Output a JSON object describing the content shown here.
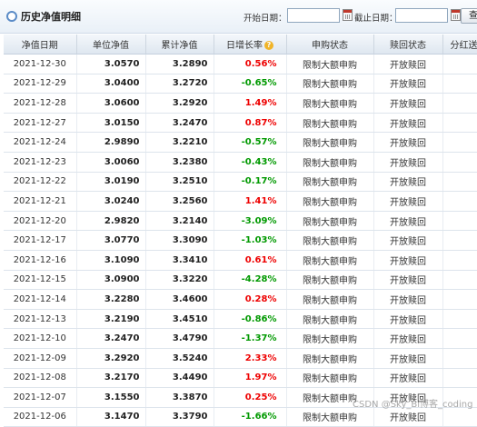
{
  "header": {
    "title": "历史净值明细",
    "start_label": "开始日期：",
    "end_label": "截止日期：",
    "start_value": "",
    "end_value": "",
    "query_label": "查"
  },
  "columns": [
    "净值日期",
    "单位净值",
    "累计净值",
    "日增长率",
    "申购状态",
    "赎回状态",
    "分红送配"
  ],
  "rows": [
    {
      "date": "2021-12-30",
      "nav": "3.0570",
      "acc": "3.2890",
      "chg": "0.56%",
      "dir": "up",
      "buy": "限制大额申购",
      "redeem": "开放赎回"
    },
    {
      "date": "2021-12-29",
      "nav": "3.0400",
      "acc": "3.2720",
      "chg": "-0.65%",
      "dir": "down",
      "buy": "限制大额申购",
      "redeem": "开放赎回"
    },
    {
      "date": "2021-12-28",
      "nav": "3.0600",
      "acc": "3.2920",
      "chg": "1.49%",
      "dir": "up",
      "buy": "限制大额申购",
      "redeem": "开放赎回"
    },
    {
      "date": "2021-12-27",
      "nav": "3.0150",
      "acc": "3.2470",
      "chg": "0.87%",
      "dir": "up",
      "buy": "限制大额申购",
      "redeem": "开放赎回"
    },
    {
      "date": "2021-12-24",
      "nav": "2.9890",
      "acc": "3.2210",
      "chg": "-0.57%",
      "dir": "down",
      "buy": "限制大额申购",
      "redeem": "开放赎回"
    },
    {
      "date": "2021-12-23",
      "nav": "3.0060",
      "acc": "3.2380",
      "chg": "-0.43%",
      "dir": "down",
      "buy": "限制大额申购",
      "redeem": "开放赎回"
    },
    {
      "date": "2021-12-22",
      "nav": "3.0190",
      "acc": "3.2510",
      "chg": "-0.17%",
      "dir": "down",
      "buy": "限制大额申购",
      "redeem": "开放赎回"
    },
    {
      "date": "2021-12-21",
      "nav": "3.0240",
      "acc": "3.2560",
      "chg": "1.41%",
      "dir": "up",
      "buy": "限制大额申购",
      "redeem": "开放赎回"
    },
    {
      "date": "2021-12-20",
      "nav": "2.9820",
      "acc": "3.2140",
      "chg": "-3.09%",
      "dir": "down",
      "buy": "限制大额申购",
      "redeem": "开放赎回"
    },
    {
      "date": "2021-12-17",
      "nav": "3.0770",
      "acc": "3.3090",
      "chg": "-1.03%",
      "dir": "down",
      "buy": "限制大额申购",
      "redeem": "开放赎回"
    },
    {
      "date": "2021-12-16",
      "nav": "3.1090",
      "acc": "3.3410",
      "chg": "0.61%",
      "dir": "up",
      "buy": "限制大额申购",
      "redeem": "开放赎回"
    },
    {
      "date": "2021-12-15",
      "nav": "3.0900",
      "acc": "3.3220",
      "chg": "-4.28%",
      "dir": "down",
      "buy": "限制大额申购",
      "redeem": "开放赎回"
    },
    {
      "date": "2021-12-14",
      "nav": "3.2280",
      "acc": "3.4600",
      "chg": "0.28%",
      "dir": "up",
      "buy": "限制大额申购",
      "redeem": "开放赎回"
    },
    {
      "date": "2021-12-13",
      "nav": "3.2190",
      "acc": "3.4510",
      "chg": "-0.86%",
      "dir": "down",
      "buy": "限制大额申购",
      "redeem": "开放赎回"
    },
    {
      "date": "2021-12-10",
      "nav": "3.2470",
      "acc": "3.4790",
      "chg": "-1.37%",
      "dir": "down",
      "buy": "限制大额申购",
      "redeem": "开放赎回"
    },
    {
      "date": "2021-12-09",
      "nav": "3.2920",
      "acc": "3.5240",
      "chg": "2.33%",
      "dir": "up",
      "buy": "限制大额申购",
      "redeem": "开放赎回"
    },
    {
      "date": "2021-12-08",
      "nav": "3.2170",
      "acc": "3.4490",
      "chg": "1.97%",
      "dir": "up",
      "buy": "限制大额申购",
      "redeem": "开放赎回"
    },
    {
      "date": "2021-12-07",
      "nav": "3.1550",
      "acc": "3.3870",
      "chg": "0.25%",
      "dir": "up",
      "buy": "限制大额申购",
      "redeem": "开放赎回"
    },
    {
      "date": "2021-12-06",
      "nav": "3.1470",
      "acc": "3.3790",
      "chg": "-1.66%",
      "dir": "down",
      "buy": "限制大额申购",
      "redeem": "开放赎回"
    }
  ],
  "colors": {
    "up": "#ee0000",
    "down": "#009900",
    "header_bg": "#e9f0f7"
  },
  "watermark": "CSDN @Sky_Bi博客_coding"
}
